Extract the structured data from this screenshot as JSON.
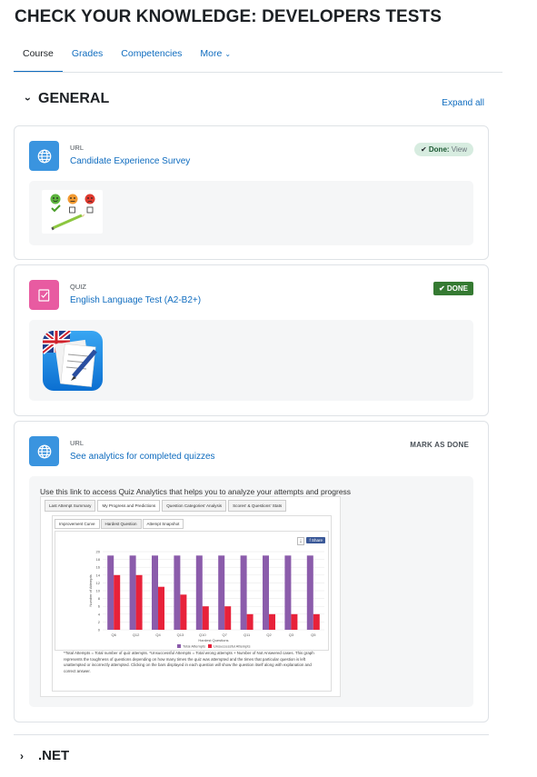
{
  "course_title": "CHECK YOUR KNOWLEDGE: DEVELOPERS TESTS",
  "nav": {
    "course": "Course",
    "grades": "Grades",
    "competencies": "Competencies",
    "more": "More"
  },
  "section1": {
    "name": "GENERAL",
    "expand_all": "Expand all"
  },
  "activities": [
    {
      "type": "URL",
      "name": "Candidate Experience Survey",
      "status_done": "Done:",
      "status_view": "View"
    },
    {
      "type": "QUIZ",
      "name": "English Language Test (A2-B2+)",
      "status": "DONE"
    },
    {
      "type": "URL",
      "name": "See analytics for completed quizzes",
      "status": "MARK AS DONE",
      "description": "Use this link to access Quiz Analytics that helps you to analyze your attempts and progress"
    }
  ],
  "analytics": {
    "tabs": [
      "Last Attempt Summary",
      "My Progress and Predictions",
      "Question Categories' Analysis",
      "Scores' & Questions' Stats"
    ],
    "inner_tabs": [
      "Improvement Curve",
      "Hardest Question",
      "Attempt Snapshot"
    ],
    "share_label": "Share",
    "footnote": "*Total Attempts = Total number of quiz attempts. *Unsuccessful Attempts = Total wrong attempts + Number of Not Answered cases. This graph represents the toughness of questions depending on how many times the quiz was attempted and the times that particular question is left unattempted or incorrectly attempted. Clicking on the bars displayed in each question will show the question itself along with explanation and correct answer."
  },
  "chart_data": {
    "type": "bar",
    "categories": [
      "Q6",
      "Q12",
      "Q4",
      "Q13",
      "Q10",
      "Q7",
      "Q11",
      "Q2",
      "Q3",
      "Q5"
    ],
    "series": [
      {
        "name": "Total Attempts",
        "values": [
          19,
          19,
          19,
          19,
          19,
          19,
          19,
          19,
          19,
          19
        ],
        "color": "#8b5cab"
      },
      {
        "name": "Unsuccessful Attempts",
        "values": [
          14,
          14,
          11,
          9,
          6,
          6,
          4,
          4,
          4,
          4
        ],
        "color": "#e8223a"
      }
    ],
    "yticks": [
      "0",
      "2",
      "4",
      "6",
      "8",
      "10",
      "12",
      "14",
      "16",
      "18",
      "20"
    ],
    "ylim": [
      0,
      20
    ],
    "ylabel": "Number of Attempts",
    "xlabel": "Hardest Questions",
    "grid": true,
    "legend": "bottom"
  },
  "section2": {
    "name": ".NET"
  }
}
